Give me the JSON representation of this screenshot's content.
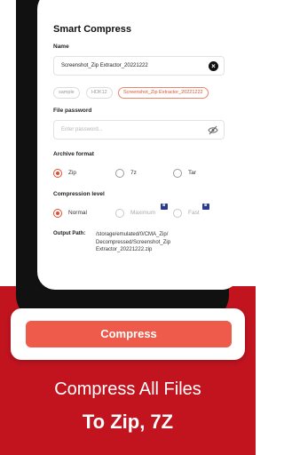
{
  "app": {
    "title": "Smart Compress"
  },
  "name_section": {
    "label": "Name",
    "value": "Screenshot_Zip Extractor_20221222",
    "chips": [
      "sample",
      "HDK12",
      "Screenshot_Zip Extractor_20221222"
    ],
    "active_chip": "Screenshot_Zip Extractor_20221222"
  },
  "password_section": {
    "label": "File password",
    "placeholder": "Enter password..."
  },
  "format_section": {
    "label": "Archive format",
    "options": [
      "Zip",
      "7z",
      "Tar"
    ],
    "selected": "Zip"
  },
  "level_section": {
    "label": "Compression level",
    "options": [
      "Normal",
      "Maximum",
      "Fast"
    ],
    "selected": "Normal",
    "premium_options": [
      "Maximum",
      "Fast"
    ]
  },
  "output": {
    "label": "Output Path:",
    "value": "/storage/emulated/0/CMA_Zip/ Decompressed/Screenshot_Zip Extractor_20221222.zip"
  },
  "action": {
    "compress_label": "Compress"
  },
  "promo": {
    "line1": "Compress All Files",
    "line2": "To Zip, 7Z"
  },
  "colors": {
    "accent": "#e0502f",
    "button": "#ee5b4b",
    "band": "#c1141f",
    "premium": "#2b3a8c"
  },
  "icons": {
    "clear": "close-circle-icon",
    "visibility": "eye-off-icon",
    "premium": "crown-icon"
  }
}
